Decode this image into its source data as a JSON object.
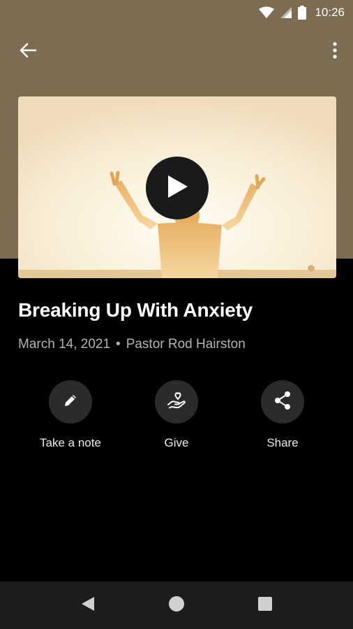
{
  "status_bar": {
    "time": "10:26",
    "icons": [
      "wifi-icon",
      "signal-icon",
      "battery-icon"
    ]
  },
  "app_bar": {
    "back_icon": "arrow-left-icon",
    "more_icon": "more-vertical-icon"
  },
  "video": {
    "play_icon": "play-icon"
  },
  "sermon": {
    "title": "Breaking Up With Anxiety",
    "date": "March 14, 2021",
    "separator": "•",
    "speaker": "Pastor Rod Hairston"
  },
  "actions": [
    {
      "label": "Take a note",
      "icon": "pencil-icon"
    },
    {
      "label": "Give",
      "icon": "give-heart-hand-icon"
    },
    {
      "label": "Share",
      "icon": "share-icon"
    }
  ],
  "nav_bar": {
    "back": "nav-back-icon",
    "home": "nav-home-icon",
    "recents": "nav-recents-icon"
  },
  "colors": {
    "header_band": "#7b6c52",
    "background": "#000000",
    "action_circle": "#2b2b2b",
    "meta_text": "#b3b3b3"
  }
}
